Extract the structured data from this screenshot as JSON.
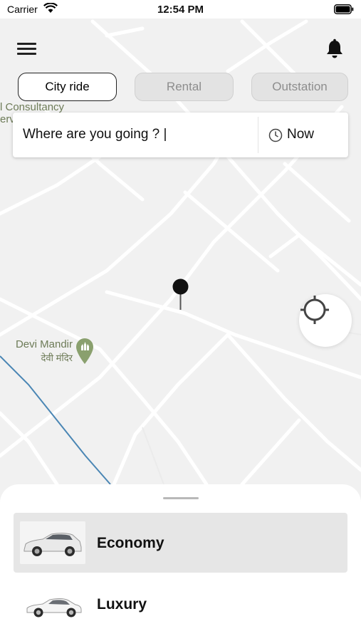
{
  "status_bar": {
    "carrier": "Carrier",
    "time": "12:54 PM"
  },
  "header": {
    "menu_icon": "hamburger-menu-icon",
    "notification_icon": "bell-icon"
  },
  "tabs": [
    {
      "label": "City ride",
      "active": true
    },
    {
      "label": "Rental",
      "active": false
    },
    {
      "label": "Outstation",
      "active": false
    }
  ],
  "search": {
    "placeholder": "Where are you going ? |",
    "time_label": "Now",
    "time_icon": "clock-icon"
  },
  "map": {
    "places": [
      {
        "line1": "l Consultancy",
        "line2": "erv"
      },
      {
        "line1": "Devi Mandir",
        "line2": "देवी मंदिर"
      }
    ],
    "pin_icon": "map-pin-icon",
    "locate_icon": "crosshair-icon"
  },
  "ride_options": [
    {
      "label": "Economy",
      "selected": true,
      "icon": "hatchback-car-icon"
    },
    {
      "label": "Luxury",
      "selected": false,
      "icon": "sedan-car-icon"
    }
  ],
  "colors": {
    "map_bg": "#f1f1f1",
    "road": "#ffffff",
    "poi_text": "#6d7b57",
    "selected_option": "#e6e6e6",
    "inactive_tab": "#e3e3e3"
  }
}
